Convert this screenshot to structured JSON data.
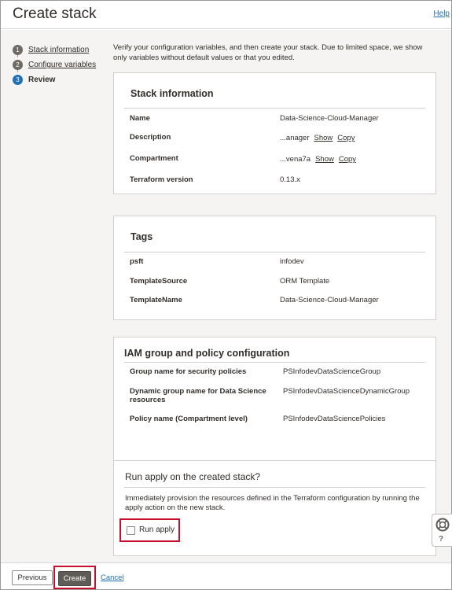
{
  "header": {
    "title": "Create stack",
    "help_label": "Help"
  },
  "steps": [
    {
      "num": "1",
      "label": "Stack information"
    },
    {
      "num": "2",
      "label": "Configure variables"
    },
    {
      "num": "3",
      "label": "Review"
    }
  ],
  "intro": "Verify your configuration variables, and then create your stack. Due to limited space, we show only variables without default values or that you edited.",
  "stack_info": {
    "title": "Stack information",
    "name_key": "Name",
    "name_val": "Data-Science-Cloud-Manager",
    "description_key": "Description",
    "description_val": "...anager",
    "compartment_key": "Compartment",
    "compartment_val": "...vena7a",
    "terraform_key": "Terraform version",
    "terraform_val": "0.13.x",
    "show_label": "Show",
    "copy_label": "Copy"
  },
  "tags": {
    "title": "Tags",
    "rows": [
      {
        "key": "psft",
        "val": "infodev"
      },
      {
        "key": "TemplateSource",
        "val": "ORM Template"
      },
      {
        "key": "TemplateName",
        "val": "Data-Science-Cloud-Manager"
      }
    ]
  },
  "iam": {
    "title": "IAM group and policy configuration",
    "rows": [
      {
        "key": "Group name for security policies",
        "val": "PSInfodevDataScienceGroup"
      },
      {
        "key": "Dynamic group name for Data Science resources",
        "val": "PSInfodevDataScienceDynamicGroup"
      },
      {
        "key": "Policy name (Compartment level)",
        "val": "PSInfodevDataSciencePolicies"
      }
    ]
  },
  "run_apply": {
    "title": "Run apply on the created stack?",
    "description": "Immediately provision the resources defined in the Terraform configuration by running the apply action on the new stack.",
    "checkbox_label": "Run apply",
    "checked": false
  },
  "help_widget": {
    "icon": "lifebuoy-icon",
    "label": "?"
  },
  "footer": {
    "previous_label": "Previous",
    "create_label": "Create",
    "cancel_label": "Cancel"
  },
  "colors": {
    "link": "#236fb4",
    "highlight": "#c8102e",
    "active_step": "#236fb4",
    "primary_button": "#5f5b57"
  }
}
